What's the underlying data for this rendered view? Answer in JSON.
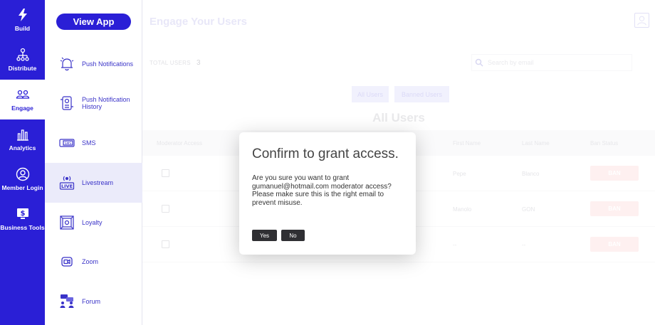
{
  "rail": {
    "items": [
      {
        "label": "Build",
        "icon": "lightning-icon"
      },
      {
        "label": "Distribute",
        "icon": "network-icon"
      },
      {
        "label": "Engage",
        "icon": "users-icon",
        "active": true
      },
      {
        "label": "Analytics",
        "icon": "bar-chart-icon"
      },
      {
        "label": "Member Login",
        "icon": "user-circle-icon"
      },
      {
        "label": "Business Tools",
        "icon": "monitor-dollar-icon"
      }
    ]
  },
  "subnav": {
    "view_app": "View App",
    "items": [
      {
        "label": "Push Notifications",
        "icon": "bell-icon"
      },
      {
        "label": "Push Notification History",
        "icon": "history-icon"
      },
      {
        "label": "SMS",
        "icon": "sms-icon"
      },
      {
        "label": "Livestream",
        "icon": "live-icon",
        "active": true
      },
      {
        "label": "Loyalty",
        "icon": "loyalty-icon"
      },
      {
        "label": "Zoom",
        "icon": "zoom-icon"
      },
      {
        "label": "Forum",
        "icon": "forum-icon"
      }
    ]
  },
  "main": {
    "title": "Engage Your Users",
    "total_label": "TOTAL USERS",
    "total_count": "3",
    "search_placeholder": "Search by email",
    "tabs": [
      "All Users",
      "Banned Users"
    ],
    "heading": "All Users",
    "columns": [
      "Moderator Access",
      "First Name",
      "Last Name",
      "Ban Status"
    ],
    "rows": [
      {
        "first": "Pepe",
        "last": "Blanco",
        "ban": "BAN"
      },
      {
        "first": "Manolo",
        "last": "GON",
        "ban": "BAN"
      },
      {
        "first": "--",
        "last": "--",
        "ban": "BAN"
      }
    ]
  },
  "modal": {
    "title": "Confirm to grant access.",
    "body": "Are you sure you want to grant gumanuel@hotmail.com moderator access? Please make sure this is the right email to prevent misuse.",
    "yes": "Yes",
    "no": "No"
  },
  "colors": {
    "brand": "#2a1fd6",
    "modal_button": "#2f2f33",
    "ban": "#fde3e3"
  }
}
